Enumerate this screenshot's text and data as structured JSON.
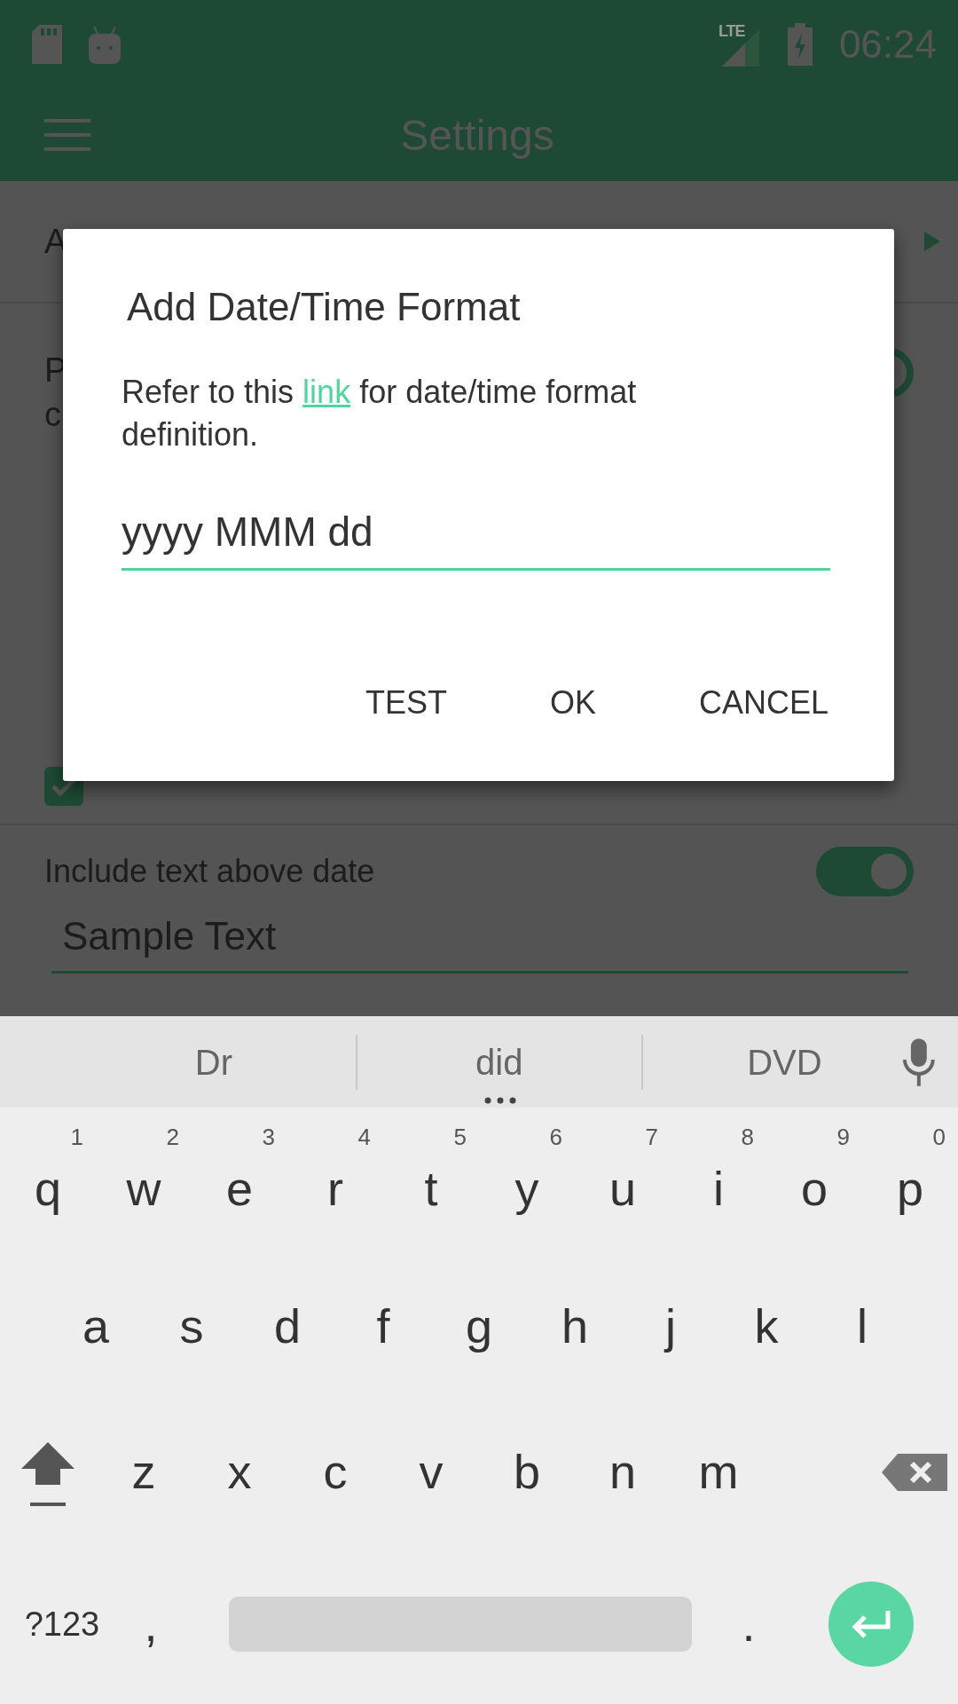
{
  "status_bar": {
    "network": "LTE",
    "time": "06:24"
  },
  "toolbar": {
    "title": "Settings"
  },
  "background": {
    "row_1_fragment": "A",
    "row_2_fragment_1": "P",
    "row_2_fragment_2": "c",
    "row_2_toggle_on": true,
    "checkbox_checked": true,
    "include_text": {
      "label": "Include text above date",
      "on": true,
      "value": "Sample Text"
    }
  },
  "dialog": {
    "title": "Add Date/Time Format",
    "message_before": "Refer to this",
    "link": "link",
    "message_after": "for date/time format definition.",
    "input_value": "yyyy MMM dd",
    "buttons": [
      "TEST",
      "OK",
      "CANCEL"
    ]
  },
  "keyboard": {
    "suggestions": [
      "Dr",
      "did",
      "DVD"
    ],
    "rows": [
      [
        {
          "label": "q",
          "hint": "1"
        },
        {
          "label": "w",
          "hint": "2"
        },
        {
          "label": "e",
          "hint": "3"
        },
        {
          "label": "r",
          "hint": "4"
        },
        {
          "label": "t",
          "hint": "5"
        },
        {
          "label": "y",
          "hint": "6"
        },
        {
          "label": "u",
          "hint": "7"
        },
        {
          "label": "i",
          "hint": "8"
        },
        {
          "label": "o",
          "hint": "9"
        },
        {
          "label": "p",
          "hint": "0"
        }
      ],
      [
        {
          "label": "a"
        },
        {
          "label": "s"
        },
        {
          "label": "d"
        },
        {
          "label": "f"
        },
        {
          "label": "g"
        },
        {
          "label": "h"
        },
        {
          "label": "j"
        },
        {
          "label": "k"
        },
        {
          "label": "l"
        }
      ],
      [
        {
          "label": "z"
        },
        {
          "label": "x"
        },
        {
          "label": "c"
        },
        {
          "label": "v"
        },
        {
          "label": "b"
        },
        {
          "label": "n"
        },
        {
          "label": "m"
        }
      ]
    ],
    "symbols_key": "?123",
    "comma_key": ",",
    "period_key": "."
  }
}
